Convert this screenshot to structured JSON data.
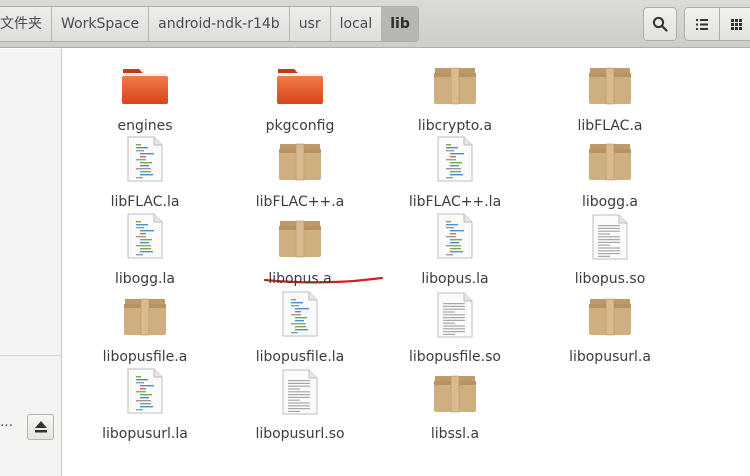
{
  "breadcrumbs": [
    "文件夹",
    "WorkSpace",
    "android-ndk-r14b",
    "usr",
    "local",
    "lib"
  ],
  "toolbar": {
    "search": "search-icon",
    "list_view": "list-view-icon",
    "grid_view": "grid-view-icon"
  },
  "sidebar": {
    "truncated_label": "…",
    "eject": "eject-icon"
  },
  "files": [
    {
      "name": "engines",
      "type": "folder"
    },
    {
      "name": "pkgconfig",
      "type": "folder"
    },
    {
      "name": "libcrypto.a",
      "type": "archive"
    },
    {
      "name": "libFLAC.a",
      "type": "archive"
    },
    {
      "name": "libFLAC.la",
      "type": "script"
    },
    {
      "name": "libFLAC++.a",
      "type": "archive"
    },
    {
      "name": "libFLAC++.la",
      "type": "script"
    },
    {
      "name": "libogg.a",
      "type": "archive"
    },
    {
      "name": "libogg.la",
      "type": "script"
    },
    {
      "name": "libopus.a",
      "type": "archive",
      "annotated": true
    },
    {
      "name": "libopus.la",
      "type": "script"
    },
    {
      "name": "libopus.so",
      "type": "text"
    },
    {
      "name": "libopusfile.a",
      "type": "archive"
    },
    {
      "name": "libopusfile.la",
      "type": "script"
    },
    {
      "name": "libopusfile.so",
      "type": "text"
    },
    {
      "name": "libopusurl.a",
      "type": "archive"
    },
    {
      "name": "libopusurl.la",
      "type": "script"
    },
    {
      "name": "libopusurl.so",
      "type": "text"
    },
    {
      "name": "libssl.a",
      "type": "archive"
    }
  ],
  "colors": {
    "annotation": "#d42020",
    "folder": "#e8562a",
    "archive": "#c9a677"
  }
}
